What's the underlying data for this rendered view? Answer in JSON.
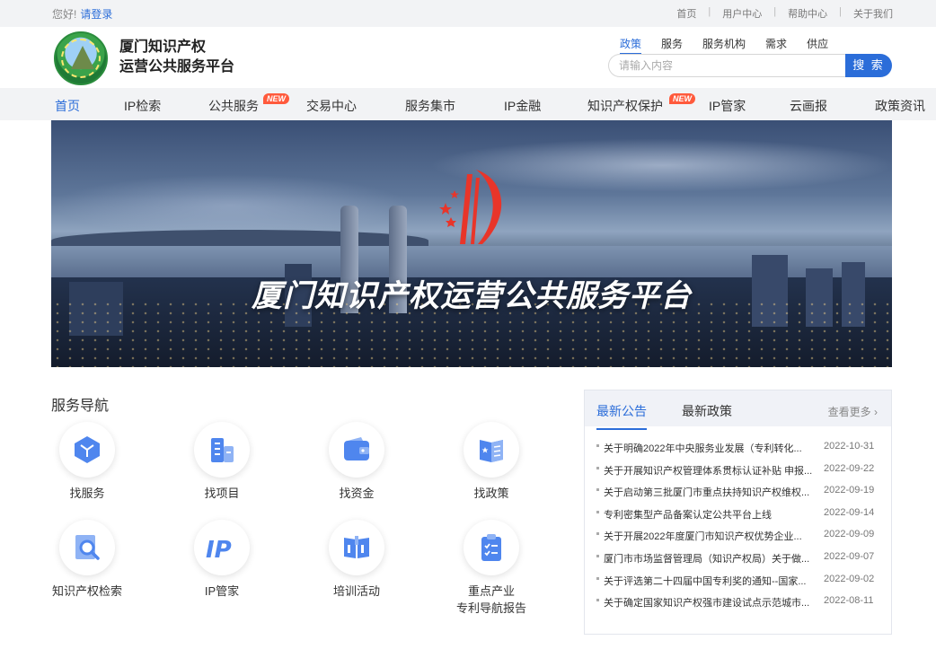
{
  "topbar": {
    "greeting": "您好!",
    "login": "请登录",
    "links": [
      "首页",
      "用户中心",
      "帮助中心",
      "关于我们"
    ]
  },
  "header": {
    "brand_line1": "厦门知识产权",
    "brand_line2": "运营公共服务平台",
    "search_tabs": [
      "政策",
      "服务",
      "服务机构",
      "需求",
      "供应"
    ],
    "search_placeholder": "请输入内容",
    "search_button": "搜 索"
  },
  "nav": {
    "items": [
      {
        "label": "首页"
      },
      {
        "label": "IP检索"
      },
      {
        "label": "公共服务",
        "badge": "NEW"
      },
      {
        "label": "交易中心"
      },
      {
        "label": "服务集市"
      },
      {
        "label": "IP金融"
      },
      {
        "label": "知识产权保护",
        "badge": "NEW"
      },
      {
        "label": "IP管家"
      },
      {
        "label": "云画报"
      },
      {
        "label": "政策资讯"
      }
    ]
  },
  "banner": {
    "title": "厦门知识产权运营公共服务平台"
  },
  "services": {
    "title": "服务导航",
    "items": [
      {
        "label": "找服务",
        "icon": "cube-icon"
      },
      {
        "label": "找项目",
        "icon": "building-icon"
      },
      {
        "label": "找资金",
        "icon": "wallet-icon"
      },
      {
        "label": "找政策",
        "icon": "book-icon"
      },
      {
        "label": "知识产权检索",
        "icon": "search-doc-icon"
      },
      {
        "label": "IP管家",
        "icon": "ip-icon"
      },
      {
        "label": "培训活动",
        "icon": "open-book-icon"
      },
      {
        "label": "重点产业\n专利导航报告",
        "line1": "重点产业",
        "line2": "专利导航报告",
        "icon": "clipboard-icon"
      }
    ]
  },
  "news": {
    "tabs": [
      "最新公告",
      "最新政策"
    ],
    "more": "查看更多",
    "items": [
      {
        "title": "关于明确2022年中央服务业发展（专利转化...",
        "date": "2022-10-31"
      },
      {
        "title": "关于开展知识产权管理体系贯标认证补贴 申报...",
        "date": "2022-09-22"
      },
      {
        "title": "关于启动第三批厦门市重点扶持知识产权维权...",
        "date": "2022-09-19"
      },
      {
        "title": "专利密集型产品备案认定公共平台上线",
        "date": "2022-09-14"
      },
      {
        "title": "关于开展2022年度厦门市知识产权优势企业...",
        "date": "2022-09-09"
      },
      {
        "title": "厦门市市场监督管理局（知识产权局）关于做...",
        "date": "2022-09-07"
      },
      {
        "title": "关于评选第二十四届中国专利奖的通知--国家...",
        "date": "2022-09-02"
      },
      {
        "title": "关于确定国家知识产权强市建设试点示范城市...",
        "date": "2022-08-11"
      }
    ]
  },
  "colors": {
    "accent": "#2b6dd9",
    "badge": "#ff5a3c",
    "icon": "#4f86ee"
  }
}
